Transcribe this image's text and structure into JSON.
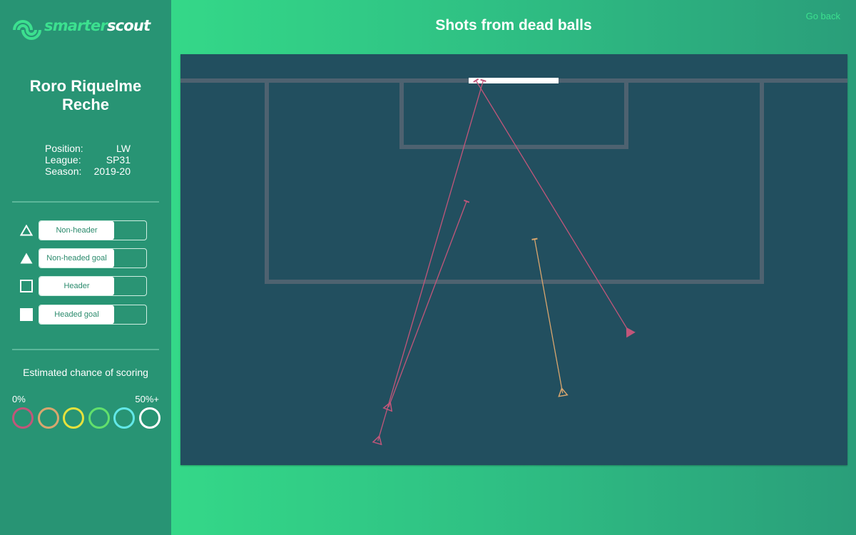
{
  "brand": {
    "part1": "smarter",
    "part2": "scout",
    "icon": "smarterscout-logo-icon"
  },
  "player": {
    "name_line1": "Roro Riquelme",
    "name_line2": "Reche",
    "details": [
      {
        "label": "Position:",
        "value": "LW"
      },
      {
        "label": "League:",
        "value": "SP31"
      },
      {
        "label": "Season:",
        "value": "2019-20"
      }
    ]
  },
  "legend": [
    {
      "icon": "triangle-outline-icon",
      "label": "Non-header",
      "enabled": true
    },
    {
      "icon": "triangle-filled-icon",
      "label": "Non-headed goal",
      "enabled": true
    },
    {
      "icon": "square-outline-icon",
      "label": "Header",
      "enabled": true
    },
    {
      "icon": "square-filled-icon",
      "label": "Headed goal",
      "enabled": true
    }
  ],
  "chance_scale": {
    "title": "Estimated chance of scoring",
    "min_label": "0%",
    "max_label": "50%+",
    "colors": [
      "#c2567a",
      "#d9a66e",
      "#e6e23c",
      "#62e06c",
      "#62e8e8",
      "#ffffff"
    ]
  },
  "header": {
    "title": "Shots from dead balls",
    "go_back": "Go back"
  },
  "colors": {
    "pitch": "#224f5f",
    "pitch_lines": "#4e6270",
    "goal": "#ffffff"
  },
  "shots": [
    {
      "type": "non-header",
      "goal": false,
      "chance_bucket": 0,
      "start": [
        0.312,
        0.859
      ],
      "end": [
        0.429,
        0.358
      ]
    },
    {
      "type": "non-header",
      "goal": false,
      "chance_bucket": 0,
      "start": [
        0.296,
        0.941
      ],
      "end": [
        0.454,
        0.064
      ]
    },
    {
      "type": "non-header",
      "goal": false,
      "chance_bucket": 1,
      "start": [
        0.573,
        0.825
      ],
      "end": [
        0.531,
        0.45
      ]
    },
    {
      "type": "non-headed goal",
      "goal": true,
      "chance_bucket": 0,
      "start": [
        0.673,
        0.677
      ],
      "end": [
        0.443,
        0.064
      ]
    }
  ]
}
